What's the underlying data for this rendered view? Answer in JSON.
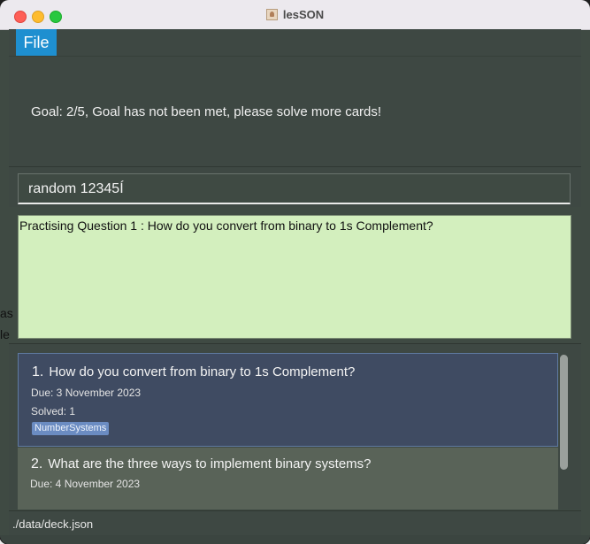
{
  "window": {
    "title": "lesSON"
  },
  "menu": {
    "file_label": "File"
  },
  "goal": {
    "text": "Goal: 2/5, Goal has not been met, please solve more cards!"
  },
  "command": {
    "value": "random 12345Í"
  },
  "result": {
    "text": "Practising Question 1 : How do you convert from binary to 1s Complement?"
  },
  "cards": [
    {
      "index": "1.",
      "question": "How do you convert from binary to 1s Complement?",
      "due": "Due: 3 November 2023",
      "solved": "Solved: 1",
      "tag": "NumberSystems"
    },
    {
      "index": "2.",
      "question": "What are the three ways to implement binary systems?",
      "due": "Due: 4 November 2023"
    }
  ],
  "status": {
    "path": "./data/deck.json"
  },
  "background": {
    "fragment1": "as",
    "fragment2": "le"
  },
  "colors": {
    "accent": "#1e8fd0",
    "result_bg": "#d3efbe",
    "selected_card": "#3f4b62",
    "tag_bg": "#6b8cc2"
  }
}
